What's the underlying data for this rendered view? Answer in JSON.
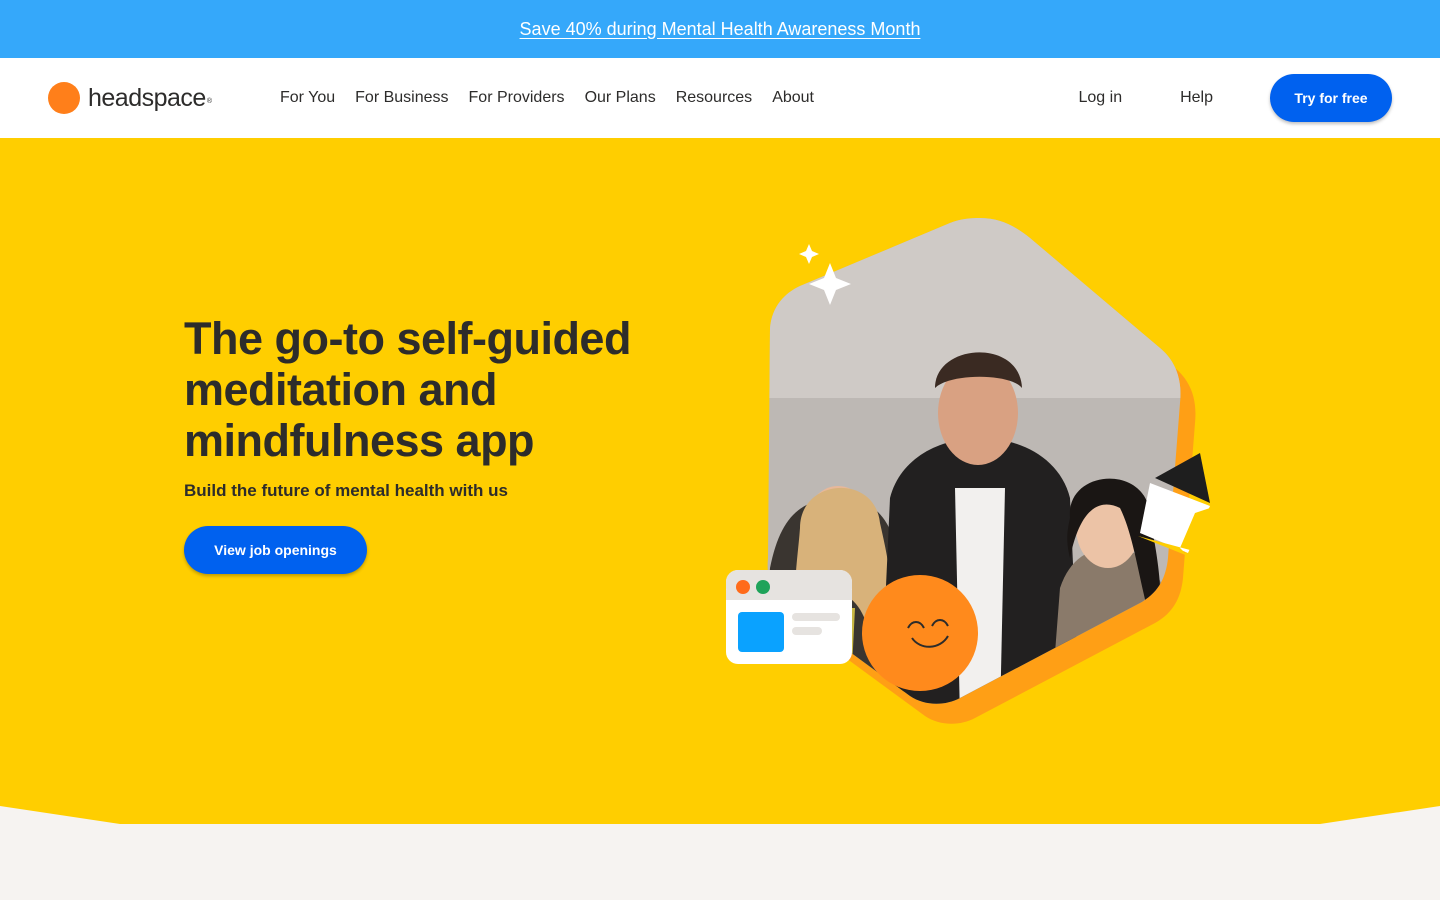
{
  "promo": {
    "text": "Save 40% during Mental Health Awareness Month"
  },
  "brand": {
    "name": "headspace",
    "trademark": "®",
    "logo_color": "#ff7f1a"
  },
  "nav": {
    "links": [
      "For You",
      "For Business",
      "For Providers",
      "Our Plans",
      "Resources",
      "About"
    ],
    "login": "Log in",
    "help": "Help",
    "cta": "Try for free"
  },
  "hero": {
    "title": "The go-to self-guided meditation and mindfulness app",
    "subtitle": "Build the future of mental health with us",
    "cta": "View job openings",
    "photo": "three-people-portrait",
    "background_color": "#ffce00"
  },
  "colors": {
    "promo_bg": "#35a8fa",
    "primary": "#0061ef",
    "accent_orange": "#ff7f1a",
    "page_bg": "#f6f3f1"
  }
}
